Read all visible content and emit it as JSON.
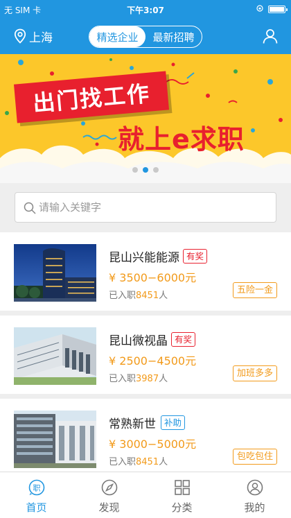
{
  "status_bar": {
    "carrier": "无 SIM 卡",
    "time": "下午3:07"
  },
  "nav": {
    "location": "上海",
    "segments": [
      {
        "label": "精选企业",
        "active": true
      },
      {
        "label": "最新招聘",
        "active": false
      }
    ],
    "profile_icon": "user-icon"
  },
  "banner": {
    "sign_text": "出门找工作",
    "slogan": "就上e求职",
    "page_count": 3,
    "active_page": 2
  },
  "search": {
    "placeholder": "请输入关键字"
  },
  "companies": [
    {
      "name": "昆山兴能能源",
      "tag": "有奖",
      "tag_type": "award",
      "salary": "¥ 3500−6000",
      "salary_unit": "元",
      "joined_prefix": "已入职",
      "joined": "8451",
      "joined_suffix": "人",
      "benefit": "五险一金"
    },
    {
      "name": "昆山微视晶",
      "tag": "有奖",
      "tag_type": "award",
      "salary": "¥ 2500−4500",
      "salary_unit": "元",
      "joined_prefix": "已入职",
      "joined": "3987",
      "joined_suffix": "人",
      "benefit": "加班多多"
    },
    {
      "name": "常熟新世",
      "tag": "补助",
      "tag_type": "subsidy",
      "salary": "¥ 3000−5000",
      "salary_unit": "元",
      "joined_prefix": "已入职",
      "joined": "8451",
      "joined_suffix": "人",
      "benefit": "包吃包住"
    }
  ],
  "tabs": [
    {
      "label": "首页",
      "icon": "home-job-icon",
      "active": true
    },
    {
      "label": "发现",
      "icon": "compass-icon",
      "active": false
    },
    {
      "label": "分类",
      "icon": "grid-icon",
      "active": false
    },
    {
      "label": "我的",
      "icon": "profile-icon",
      "active": false
    }
  ],
  "colors": {
    "primary": "#2196e0",
    "accent": "#f29a1a",
    "award": "#e8202e",
    "banner_bg": "#fcc72a"
  }
}
